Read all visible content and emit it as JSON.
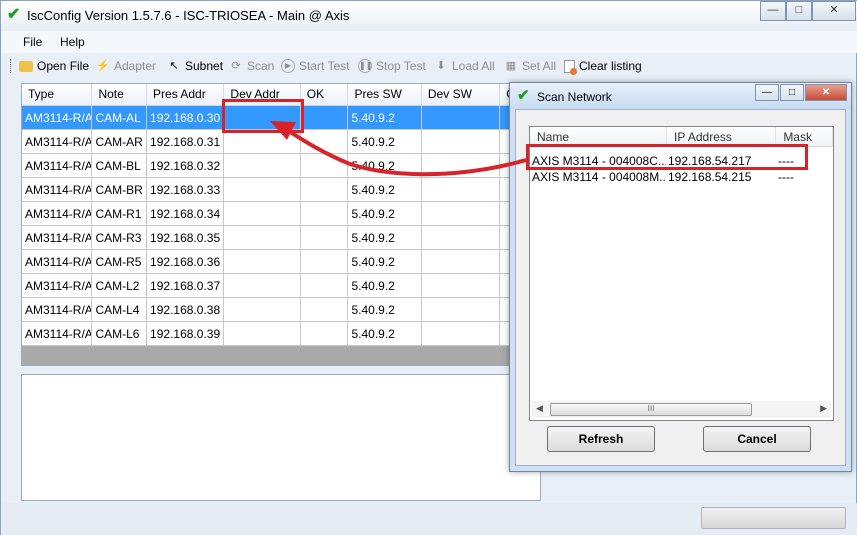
{
  "window": {
    "title": "IscConfig Version 1.5.7.6 - ISC-TRIOSEA - Main @ Axis",
    "minimize": "—",
    "restore": "□",
    "close": "✕"
  },
  "menu": {
    "items": [
      "File",
      "Help"
    ]
  },
  "toolbar": {
    "open_file": "Open File",
    "adapter": "Adapter",
    "subnet": "Subnet",
    "scan": "Scan",
    "start_test": "Start Test",
    "stop_test": "Stop Test",
    "load_all": "Load All",
    "set_all": "Set All",
    "clear_listing": "Clear listing"
  },
  "grid": {
    "columns": [
      "Type",
      "Note",
      "Pres Addr",
      "Dev Addr",
      "OK",
      "Pres SW",
      "Dev SW",
      "C"
    ],
    "rows": [
      {
        "type": "AM3114-R/A",
        "note": "CAM-AL",
        "pres_addr": "192.168.0.30",
        "dev_addr": "",
        "ok": "",
        "pres_sw": "5.40.9.2",
        "dev_sw": ""
      },
      {
        "type": "AM3114-R/A",
        "note": "CAM-AR",
        "pres_addr": "192.168.0.31",
        "dev_addr": "",
        "ok": "",
        "pres_sw": "5.40.9.2",
        "dev_sw": ""
      },
      {
        "type": "AM3114-R/A",
        "note": "CAM-BL",
        "pres_addr": "192.168.0.32",
        "dev_addr": "",
        "ok": "",
        "pres_sw": "5.40.9.2",
        "dev_sw": ""
      },
      {
        "type": "AM3114-R/A",
        "note": "CAM-BR",
        "pres_addr": "192.168.0.33",
        "dev_addr": "",
        "ok": "",
        "pres_sw": "5.40.9.2",
        "dev_sw": ""
      },
      {
        "type": "AM3114-R/A",
        "note": "CAM-R1",
        "pres_addr": "192.168.0.34",
        "dev_addr": "",
        "ok": "",
        "pres_sw": "5.40.9.2",
        "dev_sw": ""
      },
      {
        "type": "AM3114-R/A",
        "note": "CAM-R3",
        "pres_addr": "192.168.0.35",
        "dev_addr": "",
        "ok": "",
        "pres_sw": "5.40.9.2",
        "dev_sw": ""
      },
      {
        "type": "AM3114-R/A",
        "note": "CAM-R5",
        "pres_addr": "192.168.0.36",
        "dev_addr": "",
        "ok": "",
        "pres_sw": "5.40.9.2",
        "dev_sw": ""
      },
      {
        "type": "AM3114-R/A",
        "note": "CAM-L2",
        "pres_addr": "192.168.0.37",
        "dev_addr": "",
        "ok": "",
        "pres_sw": "5.40.9.2",
        "dev_sw": ""
      },
      {
        "type": "AM3114-R/A",
        "note": "CAM-L4",
        "pres_addr": "192.168.0.38",
        "dev_addr": "",
        "ok": "",
        "pres_sw": "5.40.9.2",
        "dev_sw": ""
      },
      {
        "type": "AM3114-R/A",
        "note": "CAM-L6",
        "pres_addr": "192.168.0.39",
        "dev_addr": "",
        "ok": "",
        "pres_sw": "5.40.9.2",
        "dev_sw": ""
      }
    ],
    "selected_row": 0
  },
  "dialog": {
    "title": "Scan Network",
    "columns": [
      "Name",
      "IP Address",
      "Mask"
    ],
    "rows": [
      {
        "name": "AXIS M3114 - 004008C...",
        "ip": "192.168.54.217",
        "mask": "----"
      },
      {
        "name": "AXIS M3114 - 004008M...",
        "ip": "192.168.54.215",
        "mask": "----"
      }
    ],
    "refresh_label": "Refresh",
    "cancel_label": "Cancel",
    "scroll_grip": "III"
  },
  "colors": {
    "selection": "#3399ff",
    "annotation": "#d9232a",
    "app_icon": "#1d9e22"
  }
}
